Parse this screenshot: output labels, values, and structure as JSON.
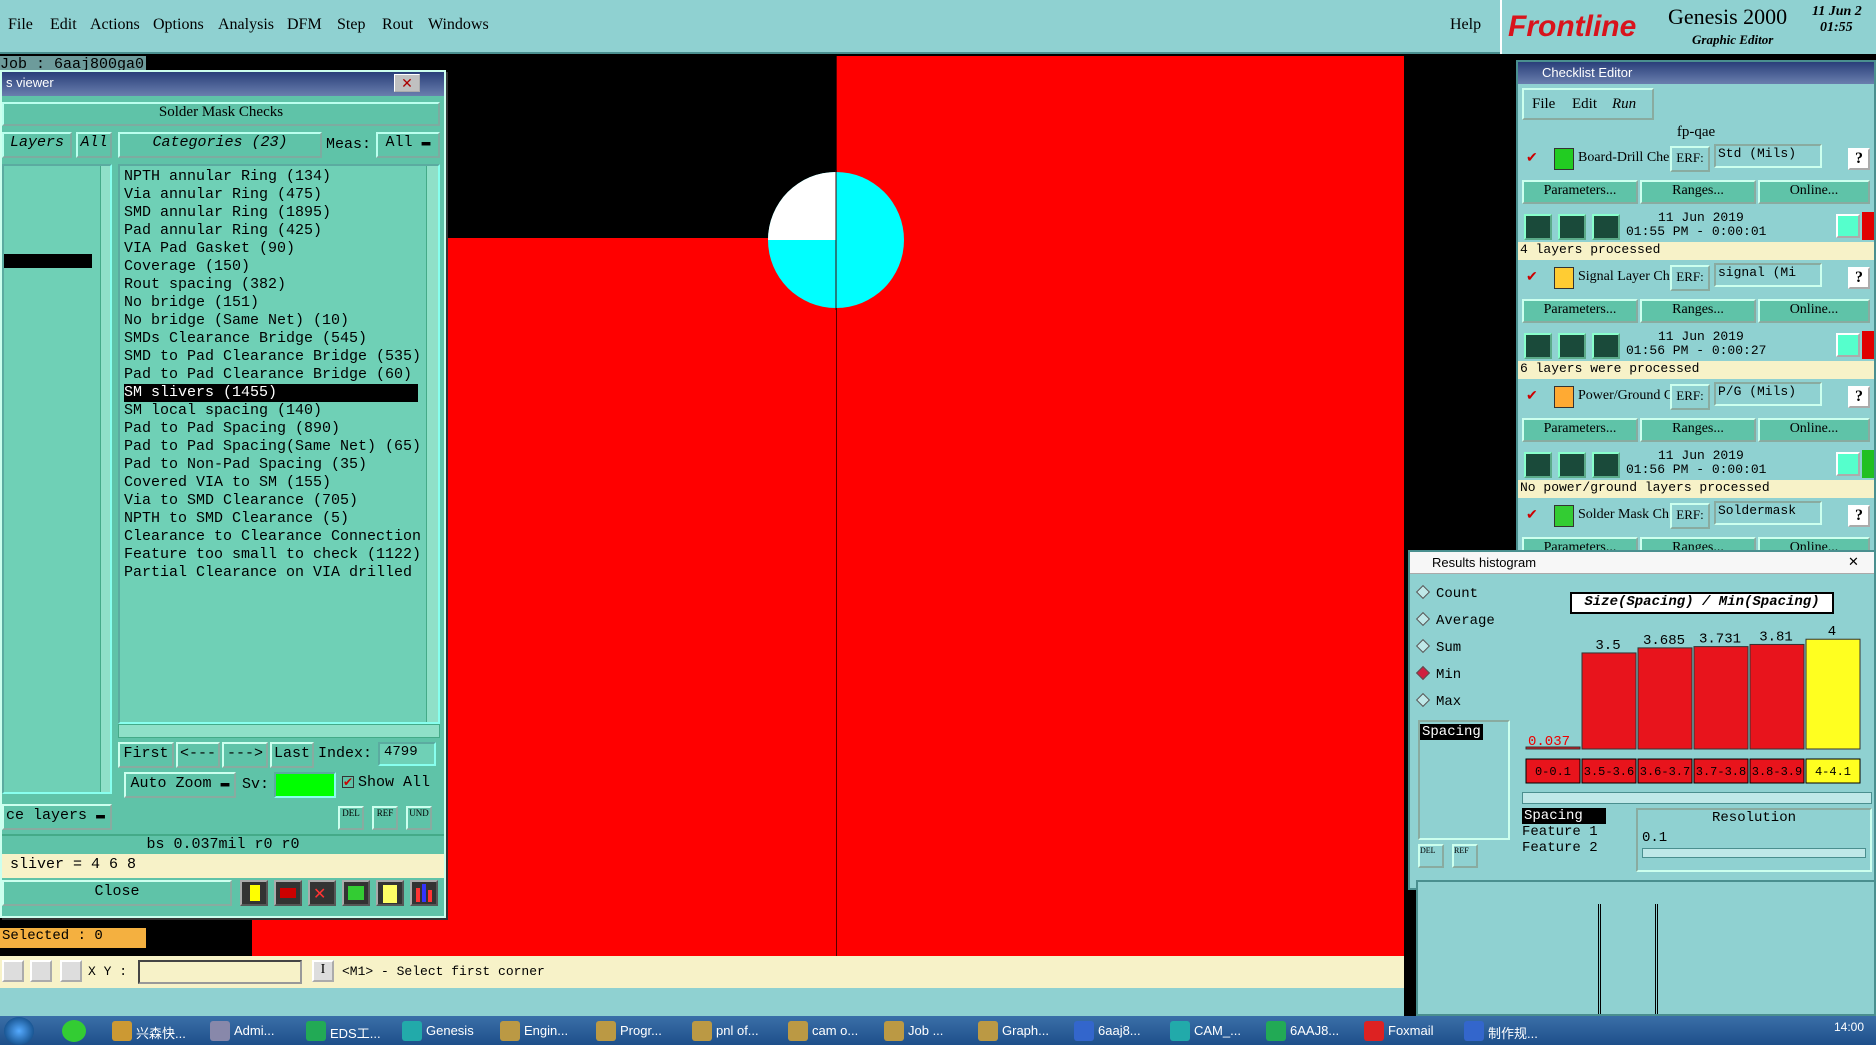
{
  "menubar": {
    "items": [
      "File",
      "Edit",
      "Actions",
      "Options",
      "Analysis",
      "DFM",
      "Step",
      "Rout",
      "Windows"
    ],
    "help": "Help"
  },
  "brand": {
    "logo": "Frontline",
    "product": "Genesis 2000",
    "subtitle": "Graphic Editor",
    "date": "11 Jun 2",
    "time": "01:55"
  },
  "job_label": "Job : 6aaj800ga0",
  "viewer": {
    "title": "s viewer",
    "header": "Solder Mask Checks",
    "layers_tab": "Layers",
    "layers_all": "All",
    "categories_tab": "Categories (23)",
    "meas_label": "Meas:",
    "meas_value": "All",
    "categories": [
      "NPTH annular Ring (134)",
      "Via annular Ring (475)",
      "SMD annular Ring (1895)",
      "Pad annular Ring (425)",
      "VIA Pad Gasket (90)",
      "Coverage (150)",
      "Rout spacing (382)",
      "No bridge (151)",
      "No bridge (Same Net) (10)",
      "SMDs Clearance Bridge (545)",
      "SMD to Pad Clearance Bridge (535)",
      "Pad to Pad Clearance Bridge (60)",
      "SM slivers (1455)",
      "SM local spacing (140)",
      "Pad to Pad Spacing (890)",
      "Pad to Pad Spacing(Same Net) (65)",
      "Pad to Non-Pad Spacing (35)",
      "Covered VIA to SM (155)",
      "Via to SMD Clearance (705)",
      "NPTH to SMD Clearance (5)",
      "Clearance to Clearance Connection",
      "Feature too small to check (1122)",
      "Partial Clearance on VIA drilled"
    ],
    "selected_index": 12,
    "nav": {
      "first": "First",
      "prev": "<---",
      "next": "--->",
      "last": "Last",
      "index_label": "Index:",
      "index_value": "4799"
    },
    "auto_zoom": "Auto Zoom",
    "sv_label": "Sv:",
    "show_all": "Show All",
    "layers_dropdown": "ce layers",
    "info_line": "bs 0.037mil  r0  r0",
    "sliver_line": "sliver = 4 6 8",
    "close": "Close"
  },
  "selected_count": "Selected : 0",
  "statusbar": {
    "xy_label": "X Y :",
    "prompt": "<M1> - Select first corner"
  },
  "checklist": {
    "title": "Checklist Editor",
    "menu": [
      "File",
      "Edit",
      "Run"
    ],
    "name": "fp-qae",
    "checks": [
      {
        "name": "Board-Drill Che",
        "erf": "ERF:",
        "erf_value": "Std (Mils)",
        "date": "11 Jun 2019",
        "time": "01:55 PM - 0:00:01",
        "status": "4 layers processed",
        "state_color": "#e00000"
      },
      {
        "name": "Signal Layer Ch",
        "erf": "ERF:",
        "erf_value": "signal (Mi",
        "date": "11 Jun 2019",
        "time": "01:56 PM - 0:00:27",
        "status": "6 layers were processed",
        "state_color": "#e00000"
      },
      {
        "name": "Power/Ground C",
        "erf": "ERF:",
        "erf_value": "P/G (Mils)",
        "date": "11 Jun 2019",
        "time": "01:56 PM - 0:00:01",
        "status": "No power/ground layers processed",
        "state_color": "#20c020"
      },
      {
        "name": "Solder Mask Ch",
        "erf": "ERF:",
        "erf_value": "Soldermask",
        "date": "",
        "time": "",
        "status": "",
        "state_color": "#8fd1d1"
      }
    ],
    "params": "Parameters...",
    "ranges": "Ranges...",
    "online": "Online..."
  },
  "histogram": {
    "title": "Results histogram",
    "modes": [
      "Count",
      "Average",
      "Sum",
      "Min",
      "Max"
    ],
    "selected_mode": "Min",
    "list_item": "Spacing",
    "header": "Size(Spacing) / Min(Spacing)",
    "bars": [
      {
        "label": "0.037",
        "range": "0-0.1",
        "value": 0.037,
        "color": "#e8141c"
      },
      {
        "label": "3.5",
        "range": "3.5-3.6",
        "value": 3.5,
        "color": "#e8141c"
      },
      {
        "label": "3.685",
        "range": "3.6-3.7",
        "value": 3.685,
        "color": "#e8141c"
      },
      {
        "label": "3.731",
        "range": "3.7-3.8",
        "value": 3.731,
        "color": "#e8141c"
      },
      {
        "label": "3.81",
        "range": "3.8-3.9",
        "value": 3.81,
        "color": "#e8141c"
      },
      {
        "label": "4",
        "range": "4-4.1",
        "value": 4,
        "color": "#ffff20"
      }
    ],
    "legend": [
      "Spacing",
      "Feature 1",
      "Feature 2"
    ],
    "resolution_label": "Resolution",
    "resolution_value": "0.1"
  },
  "taskbar": {
    "items": [
      "兴森快...",
      "Admi...",
      "EDS工...",
      "Genesis",
      "Engin...",
      "Progr...",
      "pnl of...",
      "cam o...",
      "Job ...",
      "Graph...",
      "6aaj8...",
      "CAM_...",
      "6AAJ8...",
      "Foxmail",
      "制作规..."
    ],
    "clock": "14:00"
  }
}
